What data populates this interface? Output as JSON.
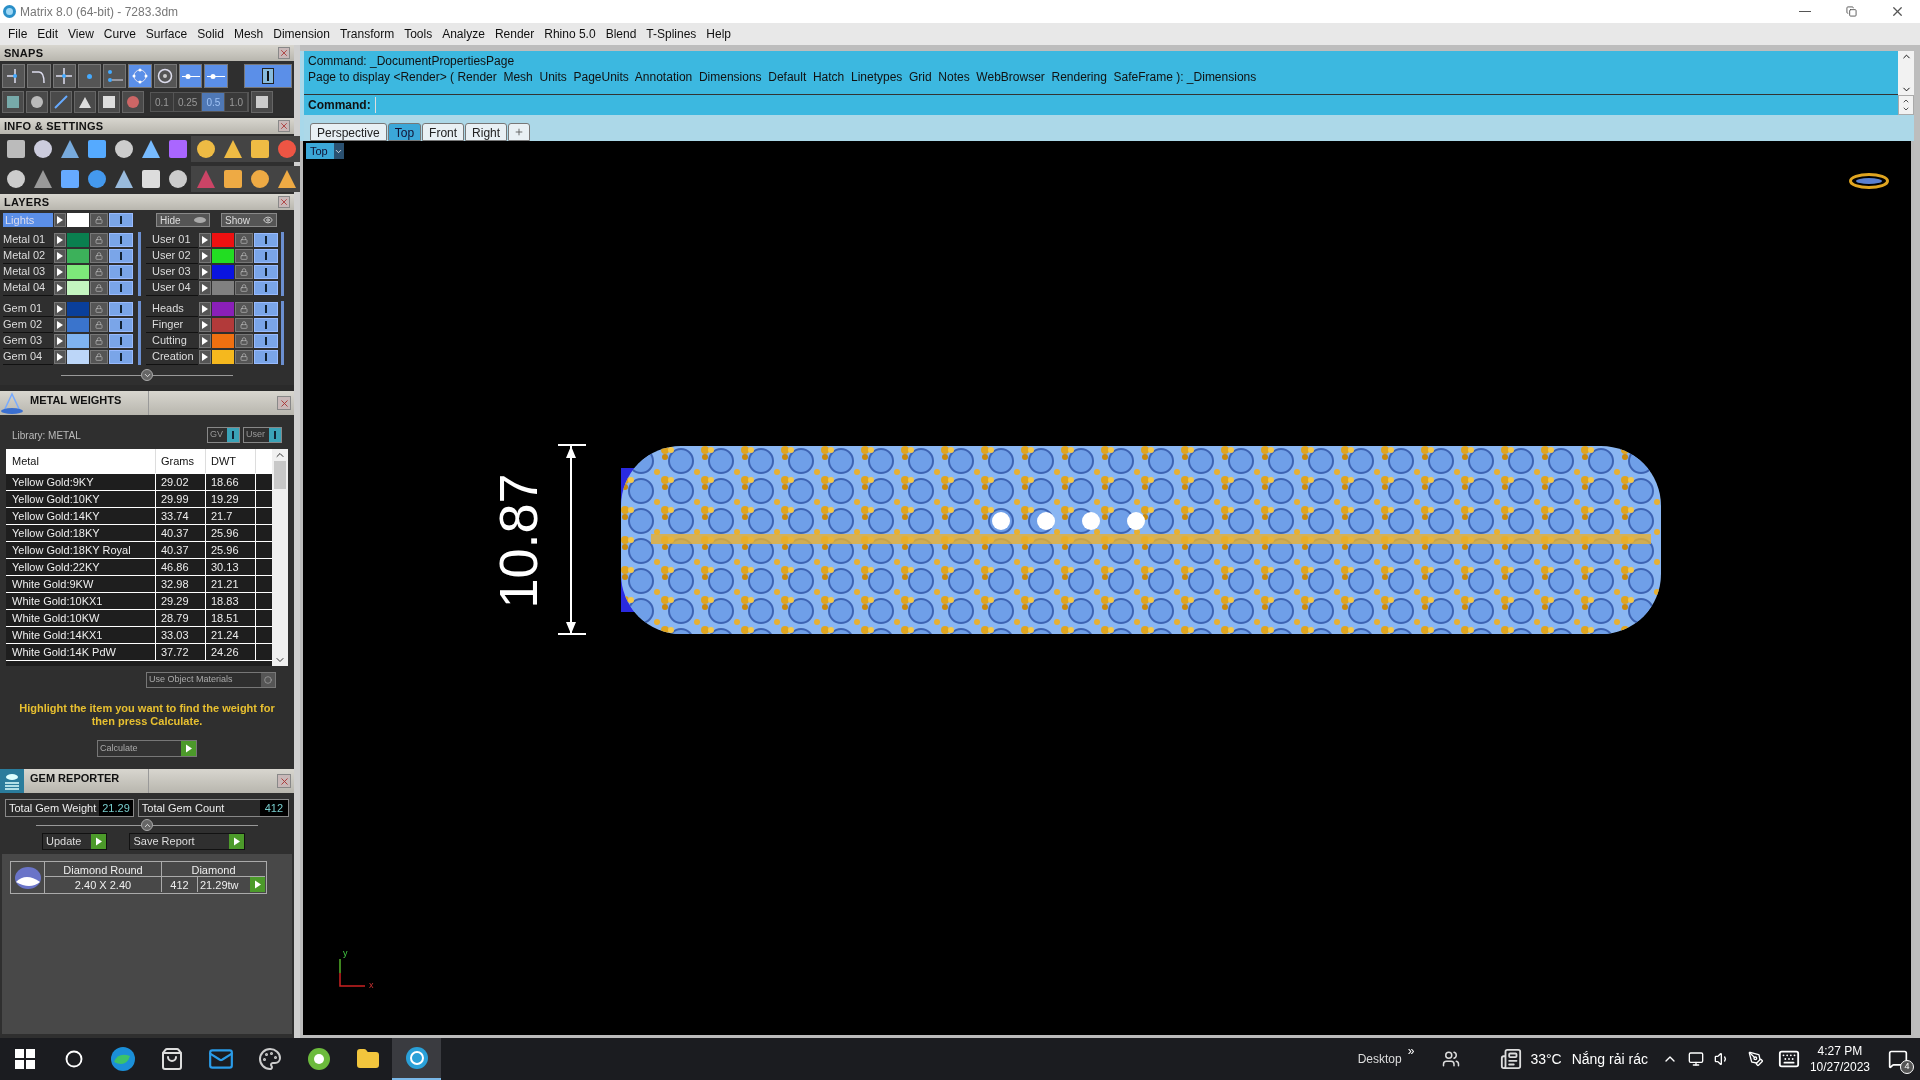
{
  "window": {
    "title": "Matrix 8.0 (64-bit) - 7283.3dm"
  },
  "menu": [
    "File",
    "Edit",
    "View",
    "Curve",
    "Surface",
    "Solid",
    "Mesh",
    "Dimension",
    "Transform",
    "Tools",
    "Analyze",
    "Render",
    "Rhino 5.0",
    "Blend",
    "T-Splines",
    "Help"
  ],
  "snaps": {
    "title": "SNAPS",
    "buttons": [
      {
        "on": false
      },
      {
        "on": false
      },
      {
        "on": false
      },
      {
        "on": false
      },
      {
        "on": false
      },
      {
        "on": true
      },
      {
        "on": false
      },
      {
        "on": true
      },
      {
        "on": true
      },
      {
        "on": true
      }
    ],
    "grid_steps": [
      {
        "label": "0.1",
        "selected": false
      },
      {
        "label": "0.25",
        "selected": false
      },
      {
        "label": "0.5",
        "selected": true
      },
      {
        "label": "1.0",
        "selected": false
      }
    ]
  },
  "info_settings": {
    "title": "INFO & SETTINGS"
  },
  "layers": {
    "title": "LAYERS",
    "lights": {
      "name": "Lights",
      "color": "#ffffff",
      "visible": true
    },
    "hide_button": "Hide",
    "show_button": "Show",
    "blocks": [
      {
        "left": [
          {
            "name": "Metal 01",
            "color": "#0a7f4f",
            "visible": true
          },
          {
            "name": "Metal 02",
            "color": "#3cb15a",
            "visible": true
          },
          {
            "name": "Metal 03",
            "color": "#7de87a",
            "visible": true
          },
          {
            "name": "Metal 04",
            "color": "#c4f5c0",
            "visible": true
          }
        ],
        "right": [
          {
            "name": "User 01",
            "color": "#ee1111",
            "visible": true
          },
          {
            "name": "User 02",
            "color": "#22dd22",
            "visible": true
          },
          {
            "name": "User 03",
            "color": "#0a14e0",
            "visible": true
          },
          {
            "name": "User 04",
            "color": "#808080",
            "visible": true
          }
        ]
      },
      {
        "left": [
          {
            "name": "Gem 01",
            "color": "#0a3f9a",
            "visible": true
          },
          {
            "name": "Gem 02",
            "color": "#3a74cc",
            "visible": true
          },
          {
            "name": "Gem 03",
            "color": "#7fb3f0",
            "visible": true
          },
          {
            "name": "Gem 04",
            "color": "#bcd6f8",
            "visible": true
          }
        ],
        "right": [
          {
            "name": "Heads",
            "color": "#8a1fb8",
            "visible": true
          },
          {
            "name": "Finger",
            "color": "#b23a3a",
            "visible": true
          },
          {
            "name": "Cutting",
            "color": "#f07010",
            "visible": true
          },
          {
            "name": "Creation",
            "color": "#f5b81e",
            "visible": true
          }
        ]
      }
    ]
  },
  "metal_weights": {
    "title": "METAL WEIGHTS",
    "library": "Library: METAL",
    "toggles": [
      {
        "label": "GV",
        "on": true
      },
      {
        "label": "User",
        "on": true
      }
    ],
    "table": {
      "columns": [
        "Metal",
        "Grams",
        "DWT"
      ],
      "rows": [
        [
          "Yellow Gold:9KY",
          "29.02",
          "18.66"
        ],
        [
          "Yellow Gold:10KY",
          "29.99",
          "19.29"
        ],
        [
          "Yellow Gold:14KY",
          "33.74",
          "21.7"
        ],
        [
          "Yellow Gold:18KY",
          "40.37",
          "25.96"
        ],
        [
          "Yellow Gold:18KY Royal",
          "40.37",
          "25.96"
        ],
        [
          "Yellow Gold:22KY",
          "46.86",
          "30.13"
        ],
        [
          "White Gold:9KW",
          "32.98",
          "21.21"
        ],
        [
          "White Gold:10KX1",
          "29.29",
          "18.83"
        ],
        [
          "White Gold:10KW",
          "28.79",
          "18.51"
        ],
        [
          "White Gold:14KX1",
          "33.03",
          "21.24"
        ],
        [
          "White Gold:14K PdW",
          "37.72",
          "24.26"
        ]
      ]
    },
    "use_object_materials": "Use Object Materials",
    "hint": "Highlight the item you want to find the weight for then press Calculate.",
    "calculate_button": "Calculate"
  },
  "gem_reporter": {
    "title": "GEM REPORTER",
    "total_weight_label": "Total Gem Weight",
    "total_weight": "21.29",
    "total_count_label": "Total Gem Count",
    "total_count": "412",
    "update_button": "Update",
    "save_button": "Save Report",
    "gems": [
      {
        "shape": "Diamond Round",
        "material": "Diamond",
        "size": "2.40 X 2.40",
        "count": "412",
        "weight": "21.29tw"
      }
    ]
  },
  "command": {
    "history": [
      "Command: _DocumentPropertiesPage",
      "Page to display <Render> ( Render  Mesh  Units  PageUnits  Annotation  Dimensions  Default  Hatch  Linetypes  Grid  Notes  WebBrowser  Rendering  SafeFrame ): _Dimensions"
    ],
    "prompt": "Command:"
  },
  "viewport_tabs": [
    {
      "label": "Perspective",
      "selected": false
    },
    {
      "label": "Top",
      "selected": true
    },
    {
      "label": "Front",
      "selected": false
    },
    {
      "label": "Right",
      "selected": false
    }
  ],
  "viewport": {
    "name": "Top",
    "dimension": "10.87",
    "axis_y": "y",
    "axis_x": "x"
  },
  "taskbar": {
    "desktop": "Desktop",
    "overflow": "»",
    "temperature": "33°C",
    "weather": "Nắng rải rác",
    "time": "4:27 PM",
    "date": "10/27/2023",
    "notifications": "4"
  }
}
